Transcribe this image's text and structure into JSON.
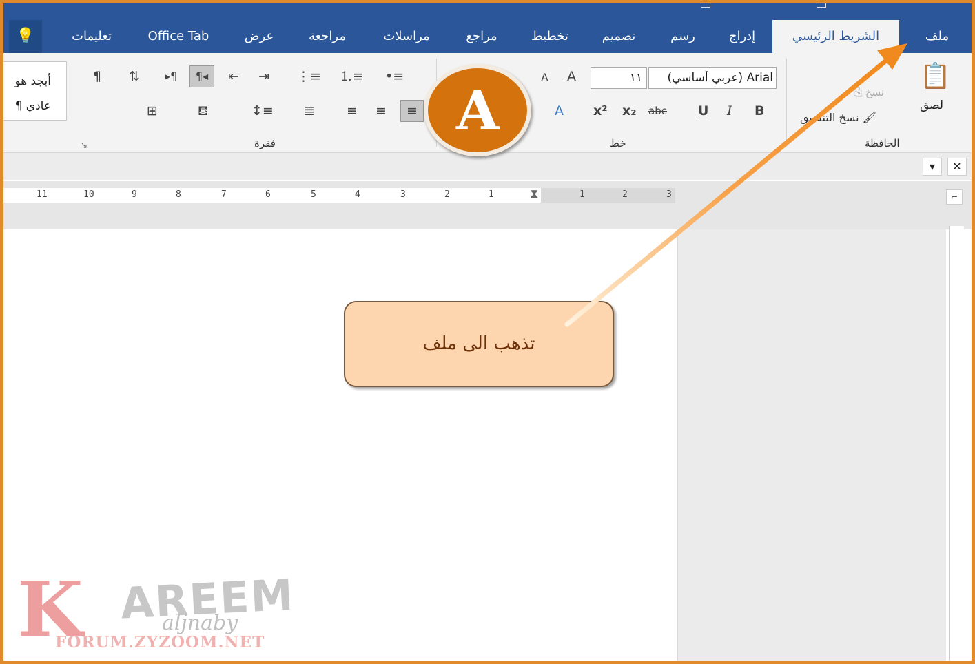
{
  "tabs": {
    "file": "ملف",
    "home": "الشريط الرئيسي",
    "insert": "إدراج",
    "draw": "رسم",
    "design": "تصميم",
    "layout": "تخطيط",
    "references": "مراجع",
    "mailings": "مراسلات",
    "review": "مراجعة",
    "view": "عرض",
    "office_tab": "Office Tab",
    "help": "تعليمات"
  },
  "ribbon": {
    "clipboard": {
      "label": "الحافظة",
      "paste": "لصق",
      "copy": "نسخ",
      "format_painter": "نسخ التنسيق"
    },
    "font": {
      "label": "خط",
      "font_name": "Arial (عربي أساسي)",
      "font_size": "١١"
    },
    "paragraph": {
      "label": "فقرة"
    },
    "styles": {
      "item1": "أبجد هو",
      "item2": "¶ عادي"
    }
  },
  "ruler": {
    "numbers": [
      "11",
      "10",
      "9",
      "8",
      "7",
      "6",
      "5",
      "4",
      "3",
      "2",
      "1",
      "1",
      "2",
      "3"
    ]
  },
  "callout": {
    "text": "تذهب الى ملف"
  },
  "badge": {
    "letter": "A"
  },
  "watermark": {
    "letter": "K",
    "name": "AREEM",
    "script": "aljnaby",
    "url": "FORUM.ZYZOOM.NET"
  },
  "colors": {
    "ribbon_blue": "#2b579a",
    "frame_orange": "#e08a2c",
    "badge_orange": "#d4720e",
    "callout_fill": "#fdd6b0"
  }
}
